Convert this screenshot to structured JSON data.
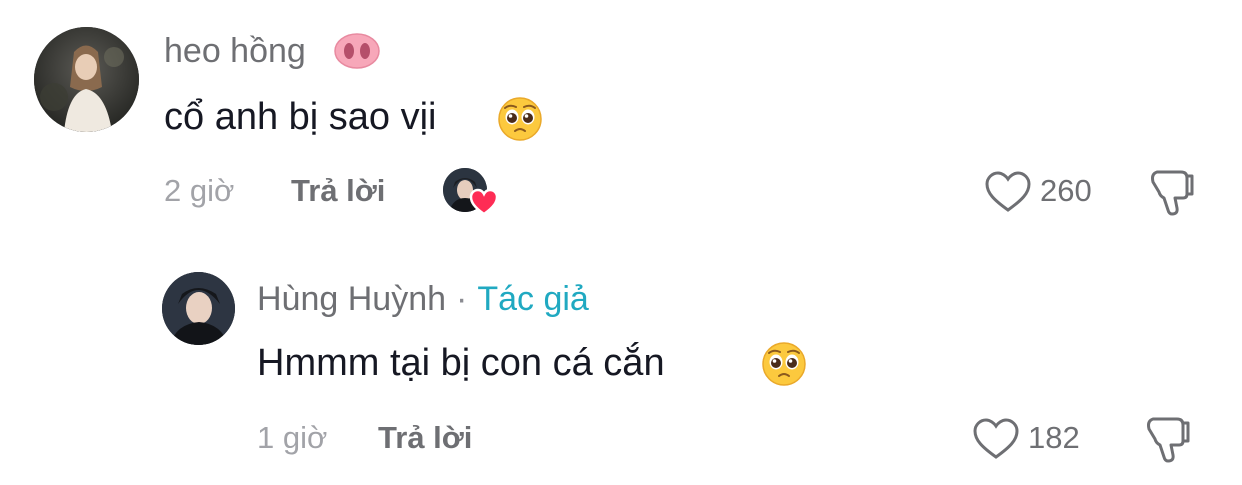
{
  "comments": [
    {
      "username": "heo hồng",
      "username_emoji": "pig-nose-icon",
      "text": "cổ anh bị sao vịi",
      "text_emoji": "pleading-face-icon",
      "time": "2 giờ",
      "reply_label": "Trả lời",
      "creator_liked": true,
      "likes": "260"
    },
    {
      "username": "Hùng Huỳnh",
      "separator": "·",
      "author_tag": "Tác giả",
      "text": "Hmmm tại bị con cá cắn",
      "text_emoji": "pleading-face-icon",
      "time": "1 giờ",
      "reply_label": "Trả lời",
      "likes": "182"
    }
  ],
  "colors": {
    "author_tag": "#20a9c1",
    "like_heart": "#fe2c55",
    "muted": "#a2a3a8"
  }
}
